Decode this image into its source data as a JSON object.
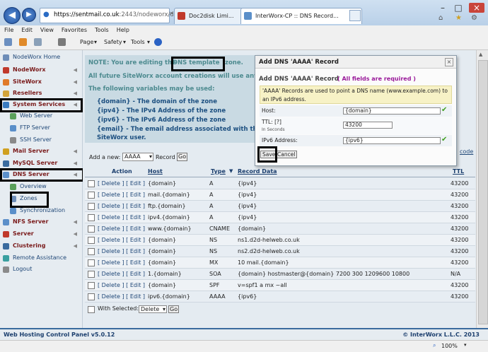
{
  "browser": {
    "url_main": "https://sentmail.co.uk",
    "url_rest": ":2443/nodeworx/dns/",
    "tabs": [
      "Doc2disk Limi...",
      "InterWorx-CP :: DNS Record..."
    ],
    "menu": [
      "File",
      "Edit",
      "View",
      "Favorites",
      "Tools",
      "Help"
    ],
    "commands": [
      "Page",
      "Safety",
      "Tools"
    ],
    "zoom": "100%"
  },
  "sidebar": {
    "items": [
      {
        "label": "NodeWorx Home",
        "kind": "sub"
      },
      {
        "label": "NodeWorx",
        "kind": "sec"
      },
      {
        "label": "SiteWorx",
        "kind": "sec"
      },
      {
        "label": "Resellers",
        "kind": "sec"
      },
      {
        "label": "System Services",
        "kind": "sec"
      },
      {
        "label": "Web Server",
        "kind": "sub"
      },
      {
        "label": "FTP Server",
        "kind": "sub"
      },
      {
        "label": "SSH Server",
        "kind": "sub"
      },
      {
        "label": "Mail Server",
        "kind": "sec"
      },
      {
        "label": "MySQL Server",
        "kind": "sec"
      },
      {
        "label": "DNS Server",
        "kind": "sec"
      },
      {
        "label": "Overview",
        "kind": "sub"
      },
      {
        "label": "Zones",
        "kind": "sub"
      },
      {
        "label": "Synchronization",
        "kind": "sub"
      },
      {
        "label": "NFS Server",
        "kind": "sec"
      },
      {
        "label": "Server",
        "kind": "sec"
      },
      {
        "label": "Clustering",
        "kind": "sec"
      },
      {
        "label": "Remote Assistance",
        "kind": "sub"
      },
      {
        "label": "Logout",
        "kind": "sub"
      }
    ]
  },
  "note": {
    "line1_pre": "NOTE: You are editing the",
    "line1_hl": "DNS template",
    "line1_post": "zone.",
    "line2": "All future SiteWorx account creations will use any c",
    "line3": "The following variables may be used:",
    "vars": [
      "{domain} - The domain of the zone",
      "{ipv4} - The IPv4 Address of the zone",
      "{ipv6} - The IPv6 Address of the zone",
      "{email} - The email address associated with the",
      "SiteWorx user."
    ]
  },
  "addnew": {
    "label": "Add a new:",
    "selected": "AAAA",
    "suffix": "Record",
    "go": "Go",
    "right_link": "code"
  },
  "table": {
    "headers": {
      "action": "Action",
      "host": "Host",
      "type": "Type",
      "rdata": "Record Data",
      "ttl": "TTL"
    },
    "delete": "Delete",
    "edit": "Edit",
    "rows": [
      {
        "host": "{domain}",
        "type": "A",
        "rdata": "{ipv4}",
        "ttl": "43200"
      },
      {
        "host": "mail.{domain}",
        "type": "A",
        "rdata": "{ipv4}",
        "ttl": "43200"
      },
      {
        "host": "ftp.{domain}",
        "type": "A",
        "rdata": "{ipv4}",
        "ttl": "43200"
      },
      {
        "host": "ipv4.{domain}",
        "type": "A",
        "rdata": "{ipv4}",
        "ttl": "43200"
      },
      {
        "host": "www.{domain}",
        "type": "CNAME",
        "rdata": "{domain}",
        "ttl": "43200"
      },
      {
        "host": "{domain}",
        "type": "NS",
        "rdata": "ns1.d2d-helweb.co.uk",
        "ttl": "43200"
      },
      {
        "host": "{domain}",
        "type": "NS",
        "rdata": "ns2.d2d-helweb.co.uk",
        "ttl": "43200"
      },
      {
        "host": "{domain}",
        "type": "MX",
        "rdata": "10 mail.{domain}",
        "ttl": "43200"
      },
      {
        "host": "1.{domain}",
        "type": "SOA",
        "rdata": "{domain} hostmaster@{domain} 7200 300 1209600 10800",
        "ttl": "N/A"
      },
      {
        "host": "{domain}",
        "type": "SPF",
        "rdata": "v=spf1 a mx ~all",
        "ttl": "43200"
      },
      {
        "host": "ipv6.{domain}",
        "type": "AAAA",
        "rdata": "{ipv6}",
        "ttl": "43200"
      }
    ],
    "with_selected": "With Selected:",
    "bulk_action": "Delete",
    "bulk_go": "Go"
  },
  "dialog": {
    "title": "Add DNS 'AAAA' Record",
    "heading": "Add DNS 'AAAA' Record",
    "required": "( All fields are required )",
    "desc": "'AAAA' Records are used to point a DNS name (www.example.com) to an IPv6 address.",
    "host_label": "Host:",
    "host_value": "{domain}",
    "ttl_label": "TTL: [?]",
    "ttl_sub": "In Seconds",
    "ttl_value": "43200",
    "ipv6_label": "IPv6 Address:",
    "ipv6_value": "{ipv6}",
    "save": "Save",
    "cancel": "Cancel"
  },
  "footer": {
    "left": "Web Hosting Control Panel v5.0.12",
    "right": "© InterWorx L.L.C. 2013"
  }
}
